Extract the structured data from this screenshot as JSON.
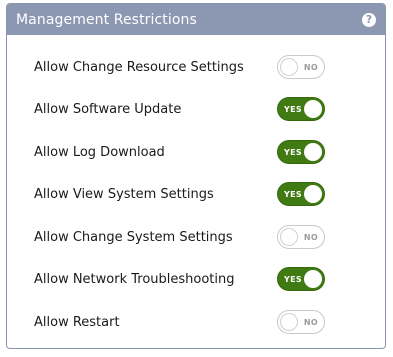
{
  "panel": {
    "title": "Management Restrictions",
    "help_icon_glyph": "?"
  },
  "toggle_labels": {
    "on": "YES",
    "off": "NO"
  },
  "colors": {
    "header_bg": "#8c98b2",
    "toggle_on": "#3f7a12"
  },
  "settings": [
    {
      "label": "Allow Change Resource Settings",
      "enabled": false,
      "state_text": "NO"
    },
    {
      "label": "Allow Software Update",
      "enabled": true,
      "state_text": "YES"
    },
    {
      "label": "Allow Log Download",
      "enabled": true,
      "state_text": "YES"
    },
    {
      "label": "Allow View System Settings",
      "enabled": true,
      "state_text": "YES"
    },
    {
      "label": "Allow Change System Settings",
      "enabled": false,
      "state_text": "NO"
    },
    {
      "label": "Allow Network Troubleshooting",
      "enabled": true,
      "state_text": "YES"
    },
    {
      "label": "Allow Restart",
      "enabled": false,
      "state_text": "NO"
    }
  ]
}
